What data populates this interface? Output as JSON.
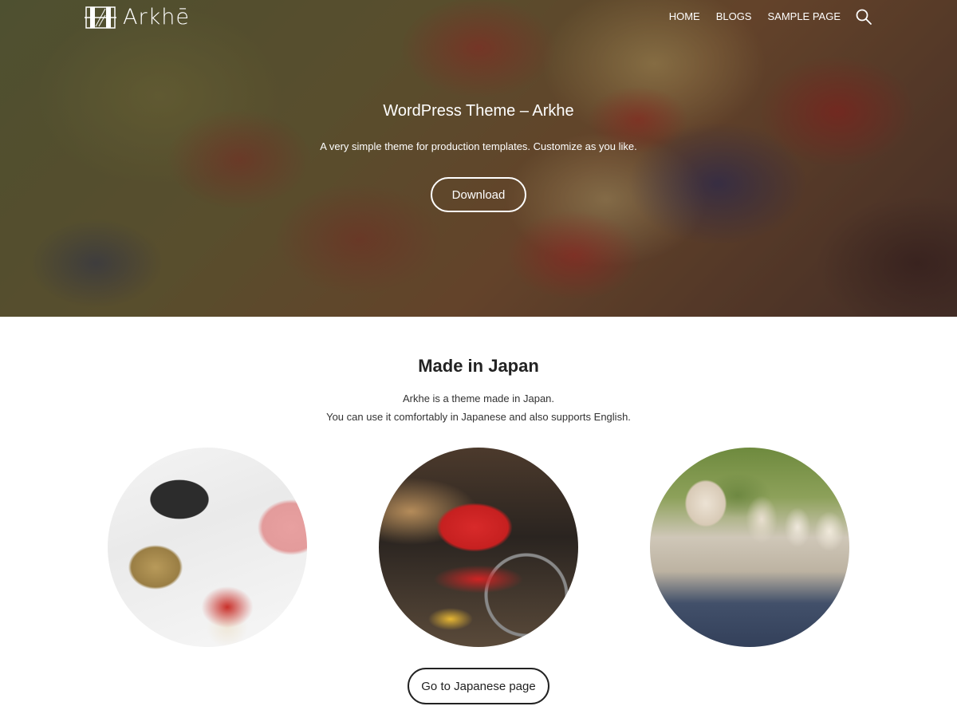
{
  "header": {
    "logo_text": "Arkhē",
    "nav": [
      {
        "label": "HOME"
      },
      {
        "label": "BLOGS"
      },
      {
        "label": "SAMPLE PAGE"
      }
    ],
    "search_icon": "search-icon"
  },
  "hero": {
    "title": "WordPress Theme – Arkhe",
    "subtitle": "A very simple theme for production templates. Customize as you like.",
    "button_label": "Download"
  },
  "section": {
    "title": "Made in Japan",
    "desc_line1": "Arkhe is a theme made in Japan.",
    "desc_line2": "You can use it comfortably in Japanese and also supports English.",
    "button_label": "Go to Japanese page"
  },
  "colors": {
    "text_dark": "#222222",
    "hero_text": "#ffffff",
    "background": "#ffffff"
  }
}
